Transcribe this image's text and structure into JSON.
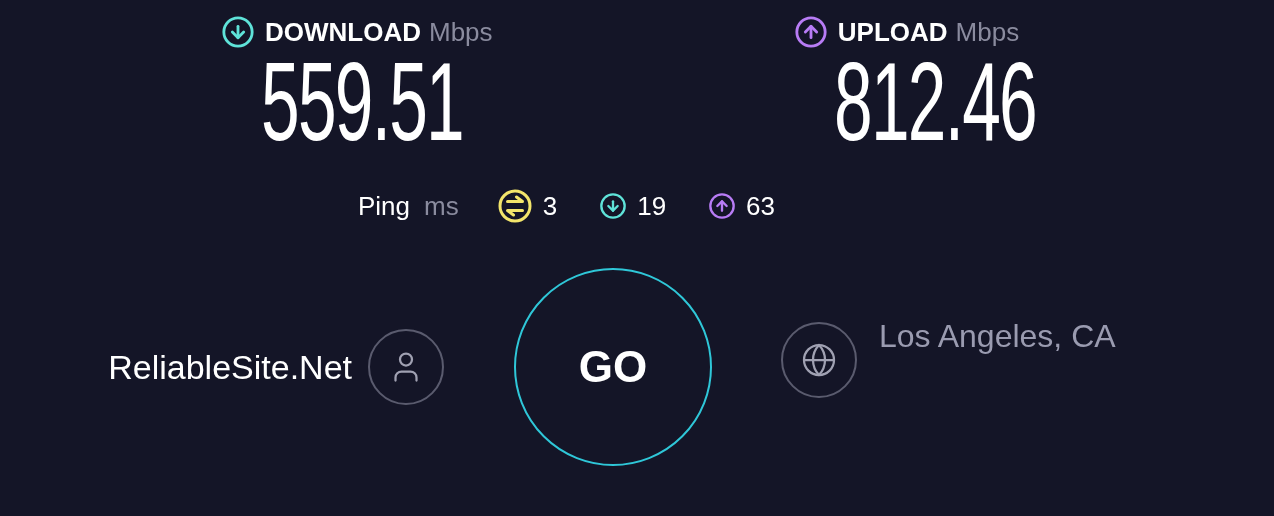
{
  "download": {
    "label": "DOWNLOAD",
    "unit": "Mbps",
    "value": "559.51"
  },
  "upload": {
    "label": "UPLOAD",
    "unit": "Mbps",
    "value": "812.46"
  },
  "ping": {
    "label": "Ping",
    "unit": "ms",
    "items": [
      {
        "kind": "ping",
        "value": "3"
      },
      {
        "kind": "download",
        "value": "19"
      },
      {
        "kind": "upload",
        "value": "63"
      }
    ]
  },
  "host": {
    "name": "ReliableSite.Net"
  },
  "go": "GO",
  "location": "Los Angeles, CA"
}
